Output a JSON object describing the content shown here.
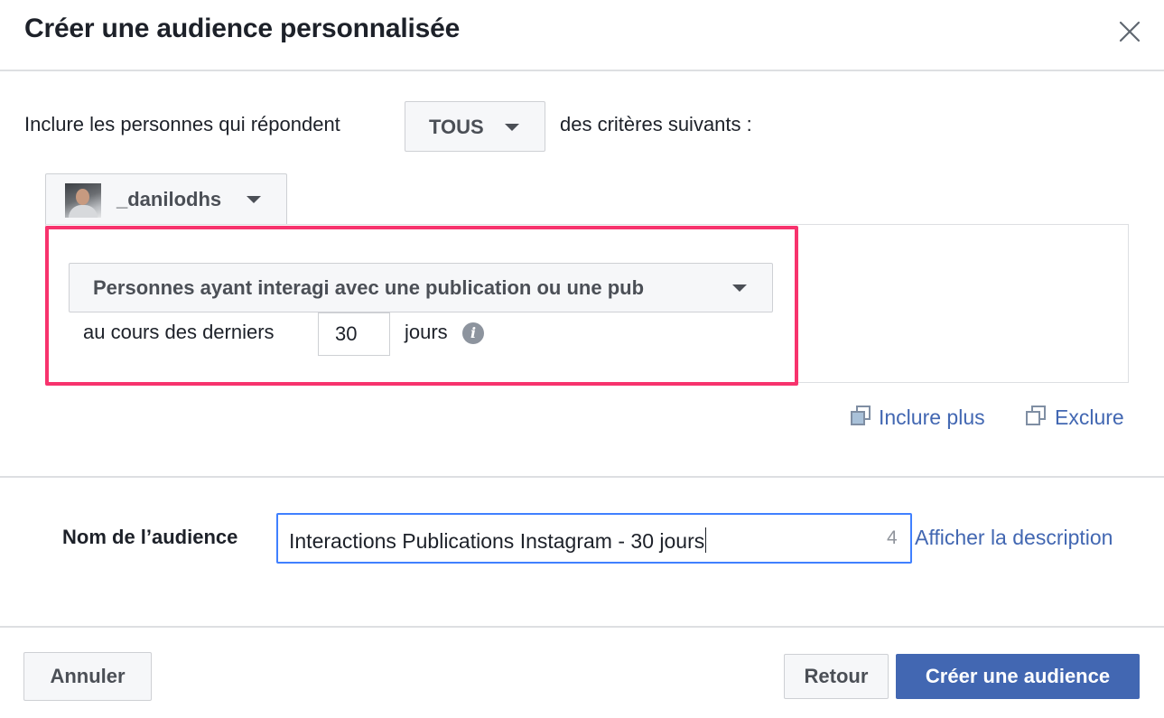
{
  "dialog": {
    "title": "Créer une audience personnalisée",
    "close_icon": "close-icon"
  },
  "criteria": {
    "prefix": "Inclure les personnes qui répondent",
    "match_value": "TOUS",
    "suffix": "des critères suivants :"
  },
  "source": {
    "account_name": "_danilodhs",
    "avatar": "avatar-photo"
  },
  "rule": {
    "event": "Personnes ayant interagi avec une publication ou une pub",
    "period_prefix": "au cours des derniers",
    "days": "30",
    "period_suffix": "jours",
    "info_icon": "info-icon",
    "highlight_color": "#f7336d"
  },
  "actions": {
    "include_more": "Inclure plus",
    "exclude": "Exclure"
  },
  "audience_name": {
    "label": "Nom de l’audience",
    "value": "Interactions Publications Instagram - 30 jours",
    "char_count": "4",
    "description_link": "Afficher la description"
  },
  "footer": {
    "cancel": "Annuler",
    "back": "Retour",
    "create": "Créer une audience"
  },
  "colors": {
    "primary": "#4267b2",
    "link": "#4267b2",
    "focus_border": "#4080ff",
    "button_bg": "#f6f7f9",
    "border": "#ced0d4"
  }
}
